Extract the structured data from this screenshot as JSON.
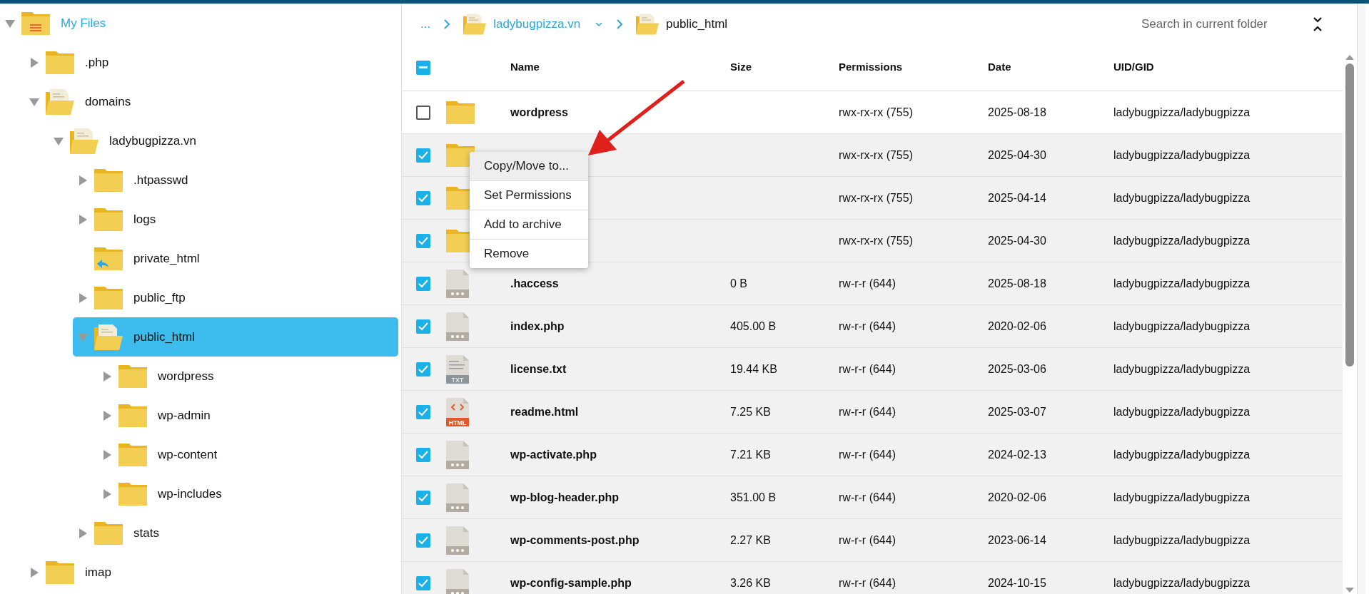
{
  "tree": [
    {
      "label": "My Files",
      "kind": "home",
      "expanded": true,
      "selected": false,
      "children": [
        {
          "label": ".php",
          "kind": "folder",
          "expanded": false,
          "selected": false
        },
        {
          "label": "domains",
          "kind": "open",
          "expanded": true,
          "selected": false,
          "children": [
            {
              "label": "ladybugpizza.vn",
              "kind": "open",
              "expanded": true,
              "selected": false,
              "children": [
                {
                  "label": ".htpasswd",
                  "kind": "folder",
                  "expanded": false,
                  "selected": false
                },
                {
                  "label": "logs",
                  "kind": "folder",
                  "expanded": false,
                  "selected": false
                },
                {
                  "label": "private_html",
                  "kind": "link",
                  "selected": false
                },
                {
                  "label": "public_ftp",
                  "kind": "folder",
                  "expanded": false,
                  "selected": false
                },
                {
                  "label": "public_html",
                  "kind": "open",
                  "expanded": true,
                  "selected": true,
                  "children": [
                    {
                      "label": "wordpress",
                      "kind": "folder",
                      "expanded": false,
                      "selected": false
                    },
                    {
                      "label": "wp-admin",
                      "kind": "folder",
                      "expanded": false,
                      "selected": false
                    },
                    {
                      "label": "wp-content",
                      "kind": "folder",
                      "expanded": false,
                      "selected": false
                    },
                    {
                      "label": "wp-includes",
                      "kind": "folder",
                      "expanded": false,
                      "selected": false
                    }
                  ]
                },
                {
                  "label": "stats",
                  "kind": "folder",
                  "expanded": false,
                  "selected": false
                }
              ]
            }
          ]
        },
        {
          "label": "imap",
          "kind": "folder",
          "expanded": false,
          "selected": false
        }
      ]
    }
  ],
  "breadcrumb": [
    {
      "label": "...",
      "kind": "ellipsis"
    },
    {
      "label": "ladybugpizza.vn",
      "kind": "folder",
      "current": false,
      "dropdown": true
    },
    {
      "label": "public_html",
      "kind": "folder",
      "current": true
    }
  ],
  "search": {
    "placeholder": "Search in current folder"
  },
  "table": {
    "select_all": {
      "indeterminate": true
    },
    "columns": [
      "Name",
      "Size",
      "Permissions",
      "Date",
      "UID/GID"
    ],
    "rows": [
      {
        "checked": false,
        "kind": "folder",
        "name": "wordpress",
        "permissions": "rwx-rx-rx (755)",
        "date": "2025-08-18",
        "uid_gid": "ladybugpizza/ladybugpizza"
      },
      {
        "checked": true,
        "kind": "folder",
        "permissions": "rwx-rx-rx (755)",
        "date": "2025-04-30",
        "uid_gid": "ladybugpizza/ladybugpizza"
      },
      {
        "checked": true,
        "kind": "folder",
        "permissions": "rwx-rx-rx (755)",
        "date": "2025-04-14",
        "uid_gid": "ladybugpizza/ladybugpizza"
      },
      {
        "checked": true,
        "kind": "folder",
        "permissions": "rwx-rx-rx (755)",
        "date": "2025-04-30",
        "uid_gid": "ladybugpizza/ladybugpizza"
      },
      {
        "checked": true,
        "kind": "file",
        "name": ".haccess",
        "size": "0 B",
        "permissions": "rw-r-r (644)",
        "date": "2025-08-18",
        "uid_gid": "ladybugpizza/ladybugpizza"
      },
      {
        "checked": true,
        "kind": "file",
        "name": "index.php",
        "size": "405.00 B",
        "permissions": "rw-r-r (644)",
        "date": "2020-02-06",
        "uid_gid": "ladybugpizza/ladybugpizza"
      },
      {
        "checked": true,
        "kind": "txt",
        "badge": "TXT",
        "name": "license.txt",
        "size": "19.44 KB",
        "permissions": "rw-r-r (644)",
        "date": "2025-03-06",
        "uid_gid": "ladybugpizza/ladybugpizza"
      },
      {
        "checked": true,
        "kind": "html",
        "badge": "HTML",
        "name": "readme.html",
        "size": "7.25 KB",
        "permissions": "rw-r-r (644)",
        "date": "2025-03-07",
        "uid_gid": "ladybugpizza/ladybugpizza"
      },
      {
        "checked": true,
        "kind": "file",
        "name": "wp-activate.php",
        "size": "7.21 KB",
        "permissions": "rw-r-r (644)",
        "date": "2024-02-13",
        "uid_gid": "ladybugpizza/ladybugpizza"
      },
      {
        "checked": true,
        "kind": "file",
        "name": "wp-blog-header.php",
        "size": "351.00 B",
        "permissions": "rw-r-r (644)",
        "date": "2020-02-06",
        "uid_gid": "ladybugpizza/ladybugpizza"
      },
      {
        "checked": true,
        "kind": "file",
        "name": "wp-comments-post.php",
        "size": "2.27 KB",
        "permissions": "rw-r-r (644)",
        "date": "2023-06-14",
        "uid_gid": "ladybugpizza/ladybugpizza"
      },
      {
        "checked": true,
        "kind": "file",
        "name": "wp-config-sample.php",
        "size": "3.26 KB",
        "permissions": "rw-r-r (644)",
        "date": "2024-10-15",
        "uid_gid": "ladybugpizza/ladybugpizza"
      }
    ]
  },
  "context_menu": {
    "items": [
      {
        "label": "Copy/Move to...",
        "selected": true
      },
      {
        "label": "Set Permissions",
        "selected": false
      },
      {
        "label": "Add to archive",
        "selected": false
      },
      {
        "label": "Remove",
        "selected": false
      }
    ]
  }
}
